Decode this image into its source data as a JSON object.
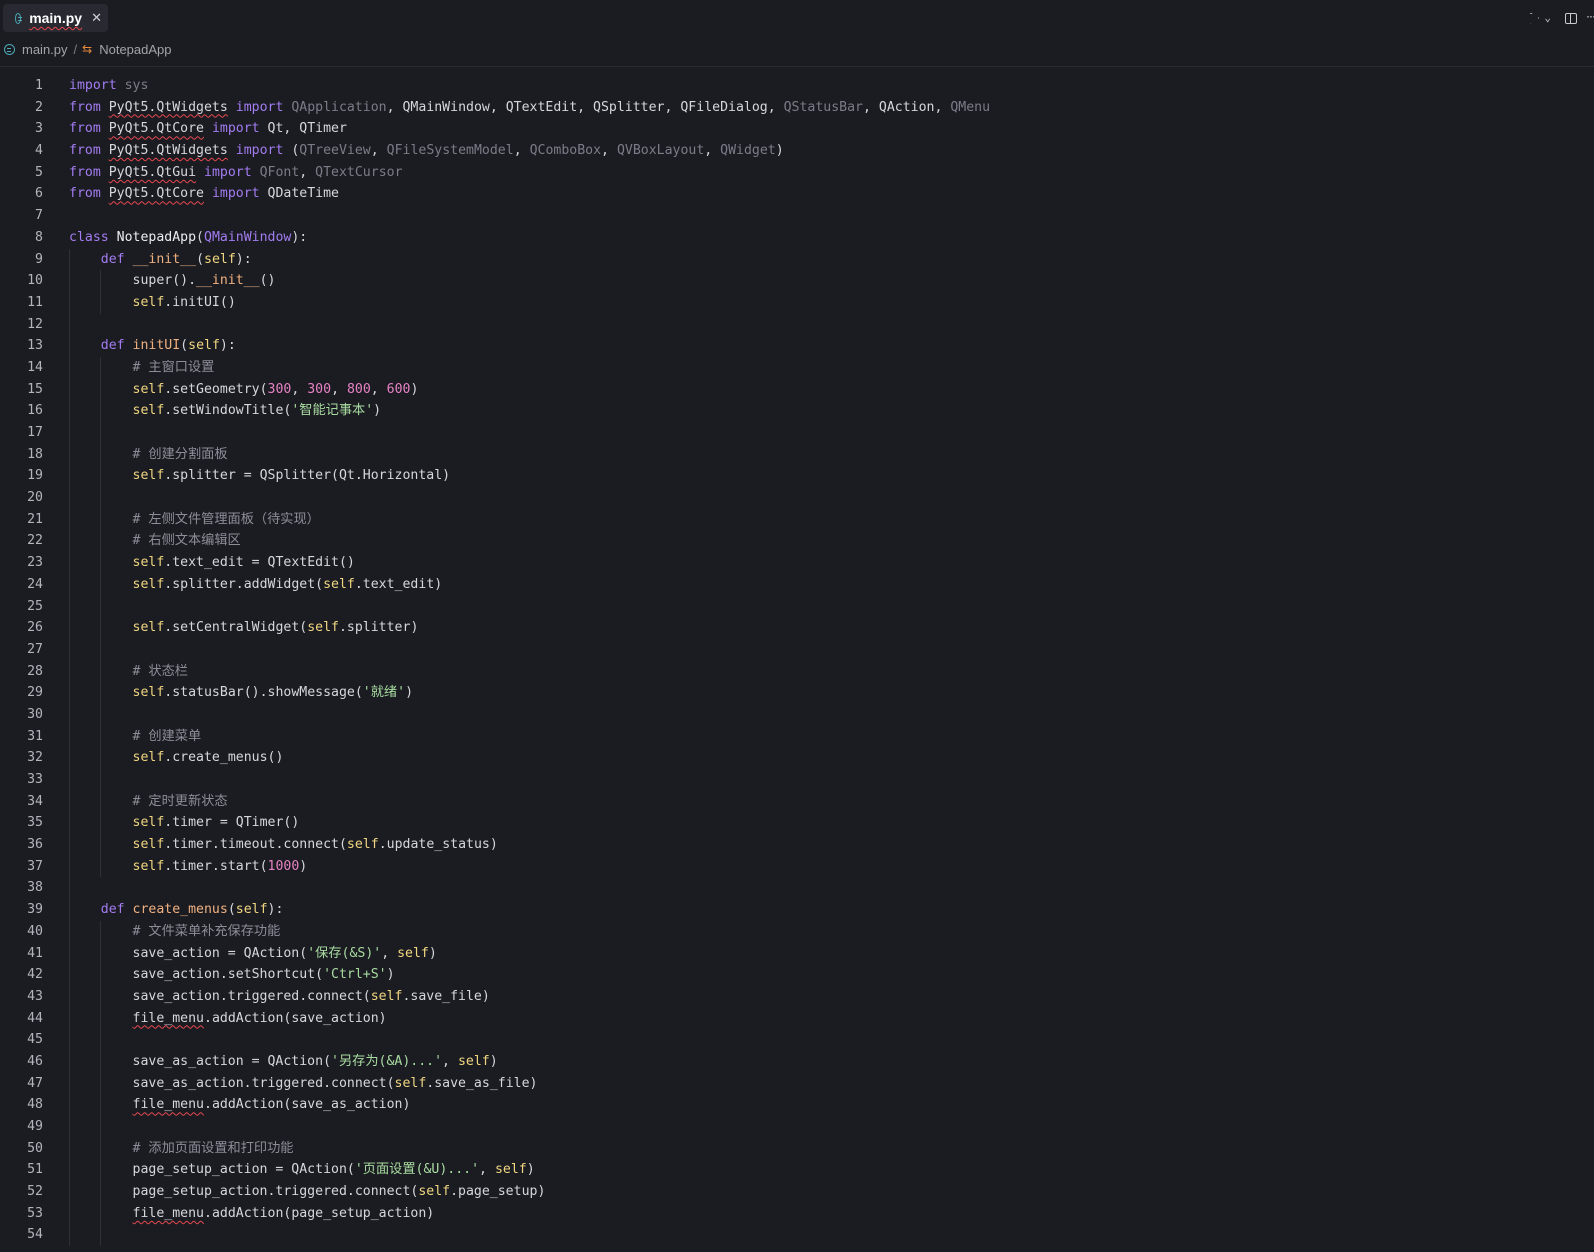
{
  "tab": {
    "label": "main.py",
    "close": "✕"
  },
  "toolbar": {
    "run": "run",
    "chevron": "⌄",
    "more": "···"
  },
  "breadcrumb": {
    "file": "main.py",
    "separator": "/",
    "symbol": "NotepadApp"
  },
  "code_lines": [
    {
      "n": "1",
      "indent": 0,
      "t": [
        [
          "kw",
          "import"
        ],
        [
          "",
          ""
        ],
        [
          "dim",
          " sys"
        ]
      ]
    },
    {
      "n": "2",
      "indent": 0,
      "t": [
        [
          "kw",
          "from "
        ],
        [
          "sq",
          "PyQt5.QtWidgets"
        ],
        [
          "",
          " "
        ],
        [
          "kw",
          "import "
        ],
        [
          "dim",
          "QApplication"
        ],
        [
          "",
          ", QMainWindow, QTextEdit, QSplitter, QFileDialog, "
        ],
        [
          "dim",
          "QStatusBar"
        ],
        [
          "",
          ", QAction, "
        ],
        [
          "dim",
          "QMenu"
        ]
      ]
    },
    {
      "n": "3",
      "indent": 0,
      "t": [
        [
          "kw",
          "from "
        ],
        [
          "sq",
          "PyQt5.QtCore"
        ],
        [
          "",
          " "
        ],
        [
          "kw",
          "import "
        ],
        [
          "",
          "Qt, QTimer"
        ]
      ]
    },
    {
      "n": "4",
      "indent": 0,
      "t": [
        [
          "kw",
          "from "
        ],
        [
          "sq",
          "PyQt5.QtWidgets"
        ],
        [
          "",
          " "
        ],
        [
          "kw",
          "import "
        ],
        [
          "",
          "("
        ],
        [
          "dim",
          "QTreeView"
        ],
        [
          "",
          ", "
        ],
        [
          "dim",
          "QFileSystemModel"
        ],
        [
          "",
          ", "
        ],
        [
          "dim",
          "QComboBox"
        ],
        [
          "",
          ", "
        ],
        [
          "dim",
          "QVBoxLayout"
        ],
        [
          "",
          ", "
        ],
        [
          "dim",
          "QWidget"
        ],
        [
          "",
          ")"
        ]
      ]
    },
    {
      "n": "5",
      "indent": 0,
      "t": [
        [
          "kw",
          "from "
        ],
        [
          "sq",
          "PyQt5.QtGui"
        ],
        [
          "",
          " "
        ],
        [
          "kw",
          "import "
        ],
        [
          "dim",
          "QFont"
        ],
        [
          "",
          ", "
        ],
        [
          "dim",
          "QTextCursor"
        ]
      ]
    },
    {
      "n": "6",
      "indent": 0,
      "t": [
        [
          "kw",
          "from "
        ],
        [
          "sq",
          "PyQt5.QtCore"
        ],
        [
          "",
          " "
        ],
        [
          "kw",
          "import "
        ],
        [
          "",
          "QDateTime"
        ]
      ]
    },
    {
      "n": "7",
      "indent": 0,
      "t": []
    },
    {
      "n": "8",
      "indent": 0,
      "t": [
        [
          "kw",
          "class "
        ],
        [
          "cls",
          "NotepadApp"
        ],
        [
          "",
          "("
        ],
        [
          "kw",
          "QMainWindow"
        ],
        [
          "",
          "):"
        ]
      ]
    },
    {
      "n": "9",
      "indent": 1,
      "t": [
        [
          "",
          "    "
        ],
        [
          "kw",
          "def "
        ],
        [
          "dunder",
          "__init__"
        ],
        [
          "",
          "("
        ],
        [
          "self",
          "self"
        ],
        [
          "",
          "):"
        ]
      ]
    },
    {
      "n": "10",
      "indent": 2,
      "t": [
        [
          "",
          "        super()."
        ],
        [
          "dunder",
          "__init__"
        ],
        [
          "",
          "()"
        ]
      ]
    },
    {
      "n": "11",
      "indent": 2,
      "t": [
        [
          "",
          "        "
        ],
        [
          "self",
          "self"
        ],
        [
          "",
          ".initUI()"
        ]
      ]
    },
    {
      "n": "12",
      "indent": 1,
      "t": []
    },
    {
      "n": "13",
      "indent": 1,
      "t": [
        [
          "",
          "    "
        ],
        [
          "kw",
          "def "
        ],
        [
          "fn",
          "initUI"
        ],
        [
          "",
          "("
        ],
        [
          "self",
          "self"
        ],
        [
          "",
          "):"
        ]
      ]
    },
    {
      "n": "14",
      "indent": 2,
      "t": [
        [
          "",
          "        "
        ],
        [
          "cm",
          "# 主窗口设置"
        ]
      ]
    },
    {
      "n": "15",
      "indent": 2,
      "t": [
        [
          "",
          "        "
        ],
        [
          "self",
          "self"
        ],
        [
          "",
          ".setGeometry("
        ],
        [
          "num",
          "300"
        ],
        [
          "",
          ", "
        ],
        [
          "num",
          "300"
        ],
        [
          "",
          ", "
        ],
        [
          "num",
          "800"
        ],
        [
          "",
          ", "
        ],
        [
          "num",
          "600"
        ],
        [
          "",
          ")"
        ]
      ]
    },
    {
      "n": "16",
      "indent": 2,
      "t": [
        [
          "",
          "        "
        ],
        [
          "self",
          "self"
        ],
        [
          "",
          ".setWindowTitle("
        ],
        [
          "str",
          "'智能记事本'"
        ],
        [
          "",
          ")"
        ]
      ]
    },
    {
      "n": "17",
      "indent": 2,
      "t": []
    },
    {
      "n": "18",
      "indent": 2,
      "t": [
        [
          "",
          "        "
        ],
        [
          "cm",
          "# 创建分割面板"
        ]
      ]
    },
    {
      "n": "19",
      "indent": 2,
      "t": [
        [
          "",
          "        "
        ],
        [
          "self",
          "self"
        ],
        [
          "",
          ".splitter = QSplitter(Qt.Horizontal)"
        ]
      ]
    },
    {
      "n": "20",
      "indent": 2,
      "t": []
    },
    {
      "n": "21",
      "indent": 2,
      "t": [
        [
          "",
          "        "
        ],
        [
          "cm",
          "# 左侧文件管理面板（待实现）"
        ]
      ]
    },
    {
      "n": "22",
      "indent": 2,
      "t": [
        [
          "",
          "        "
        ],
        [
          "cm",
          "# 右侧文本编辑区"
        ]
      ]
    },
    {
      "n": "23",
      "indent": 2,
      "t": [
        [
          "",
          "        "
        ],
        [
          "self",
          "self"
        ],
        [
          "",
          ".text_edit = QTextEdit()"
        ]
      ]
    },
    {
      "n": "24",
      "indent": 2,
      "t": [
        [
          "",
          "        "
        ],
        [
          "self",
          "self"
        ],
        [
          "",
          ".splitter.addWidget("
        ],
        [
          "self",
          "self"
        ],
        [
          "",
          ".text_edit)"
        ]
      ]
    },
    {
      "n": "25",
      "indent": 2,
      "t": []
    },
    {
      "n": "26",
      "indent": 2,
      "t": [
        [
          "",
          "        "
        ],
        [
          "self",
          "self"
        ],
        [
          "",
          ".setCentralWidget("
        ],
        [
          "self",
          "self"
        ],
        [
          "",
          ".splitter)"
        ]
      ]
    },
    {
      "n": "27",
      "indent": 2,
      "t": []
    },
    {
      "n": "28",
      "indent": 2,
      "t": [
        [
          "",
          "        "
        ],
        [
          "cm",
          "# 状态栏"
        ]
      ]
    },
    {
      "n": "29",
      "indent": 2,
      "t": [
        [
          "",
          "        "
        ],
        [
          "self",
          "self"
        ],
        [
          "",
          ".statusBar().showMessage("
        ],
        [
          "str",
          "'就绪'"
        ],
        [
          "",
          ")"
        ]
      ]
    },
    {
      "n": "30",
      "indent": 2,
      "t": []
    },
    {
      "n": "31",
      "indent": 2,
      "t": [
        [
          "",
          "        "
        ],
        [
          "cm",
          "# 创建菜单"
        ]
      ]
    },
    {
      "n": "32",
      "indent": 2,
      "t": [
        [
          "",
          "        "
        ],
        [
          "self",
          "self"
        ],
        [
          "",
          ".create_menus()"
        ]
      ]
    },
    {
      "n": "33",
      "indent": 2,
      "t": []
    },
    {
      "n": "34",
      "indent": 2,
      "t": [
        [
          "",
          "        "
        ],
        [
          "cm",
          "# 定时更新状态"
        ]
      ]
    },
    {
      "n": "35",
      "indent": 2,
      "t": [
        [
          "",
          "        "
        ],
        [
          "self",
          "self"
        ],
        [
          "",
          ".timer = QTimer()"
        ]
      ]
    },
    {
      "n": "36",
      "indent": 2,
      "t": [
        [
          "",
          "        "
        ],
        [
          "self",
          "self"
        ],
        [
          "",
          ".timer.timeout.connect("
        ],
        [
          "self",
          "self"
        ],
        [
          "",
          ".update_status)"
        ]
      ]
    },
    {
      "n": "37",
      "indent": 2,
      "t": [
        [
          "",
          "        "
        ],
        [
          "self",
          "self"
        ],
        [
          "",
          ".timer.start("
        ],
        [
          "num",
          "1000"
        ],
        [
          "",
          ")"
        ]
      ]
    },
    {
      "n": "38",
      "indent": 1,
      "t": []
    },
    {
      "n": "39",
      "indent": 1,
      "t": [
        [
          "",
          "    "
        ],
        [
          "kw",
          "def "
        ],
        [
          "fn",
          "create_menus"
        ],
        [
          "",
          "("
        ],
        [
          "self",
          "self"
        ],
        [
          "",
          "):"
        ]
      ]
    },
    {
      "n": "40",
      "indent": 2,
      "t": [
        [
          "",
          "        "
        ],
        [
          "cm",
          "# 文件菜单补充保存功能"
        ]
      ]
    },
    {
      "n": "41",
      "indent": 2,
      "t": [
        [
          "",
          "        save_action = QAction("
        ],
        [
          "str",
          "'保存(&S)'"
        ],
        [
          "",
          ", "
        ],
        [
          "self",
          "self"
        ],
        [
          "",
          ")"
        ]
      ]
    },
    {
      "n": "42",
      "indent": 2,
      "t": [
        [
          "",
          "        save_action.setShortcut("
        ],
        [
          "str",
          "'Ctrl+S'"
        ],
        [
          "",
          ")"
        ]
      ]
    },
    {
      "n": "43",
      "indent": 2,
      "t": [
        [
          "",
          "        save_action.triggered.connect("
        ],
        [
          "self",
          "self"
        ],
        [
          "",
          ".save_file)"
        ]
      ]
    },
    {
      "n": "44",
      "indent": 2,
      "t": [
        [
          "",
          "        "
        ],
        [
          "sq",
          "file_menu"
        ],
        [
          "",
          ".addAction(save_action)"
        ]
      ]
    },
    {
      "n": "45",
      "indent": 2,
      "t": []
    },
    {
      "n": "46",
      "indent": 2,
      "t": [
        [
          "",
          "        save_as_action = QAction("
        ],
        [
          "str",
          "'另存为(&A)...'"
        ],
        [
          "",
          ", "
        ],
        [
          "self",
          "self"
        ],
        [
          "",
          ")"
        ]
      ]
    },
    {
      "n": "47",
      "indent": 2,
      "t": [
        [
          "",
          "        save_as_action.triggered.connect("
        ],
        [
          "self",
          "self"
        ],
        [
          "",
          ".save_as_file)"
        ]
      ]
    },
    {
      "n": "48",
      "indent": 2,
      "t": [
        [
          "",
          "        "
        ],
        [
          "sq",
          "file_menu"
        ],
        [
          "",
          ".addAction(save_as_action)"
        ]
      ]
    },
    {
      "n": "49",
      "indent": 2,
      "t": []
    },
    {
      "n": "50",
      "indent": 2,
      "t": [
        [
          "",
          "        "
        ],
        [
          "cm",
          "# 添加页面设置和打印功能"
        ]
      ]
    },
    {
      "n": "51",
      "indent": 2,
      "t": [
        [
          "",
          "        page_setup_action = QAction("
        ],
        [
          "str",
          "'页面设置(&U)...'"
        ],
        [
          "",
          ", "
        ],
        [
          "self",
          "self"
        ],
        [
          "",
          ")"
        ]
      ]
    },
    {
      "n": "52",
      "indent": 2,
      "t": [
        [
          "",
          "        page_setup_action.triggered.connect("
        ],
        [
          "self",
          "self"
        ],
        [
          "",
          ".page_setup)"
        ]
      ]
    },
    {
      "n": "53",
      "indent": 2,
      "t": [
        [
          "",
          "        "
        ],
        [
          "sq",
          "file_menu"
        ],
        [
          "",
          ".addAction(page_setup_action)"
        ]
      ]
    },
    {
      "n": "54",
      "indent": 2,
      "t": []
    }
  ]
}
